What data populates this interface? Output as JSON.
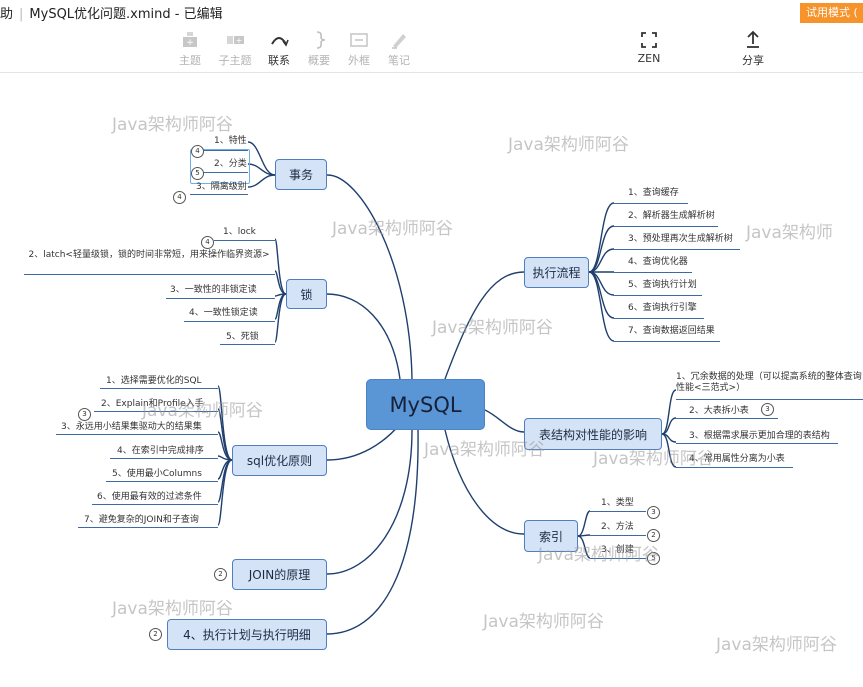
{
  "window": {
    "title_prefix": "助",
    "title": "MySQL优化问题.xmind - 已编辑",
    "trial_label": "试用模式 (",
    "toolbar": [
      {
        "label": "主题",
        "icon": "topic-icon",
        "enabled": false
      },
      {
        "label": "子主题",
        "icon": "subtopic-icon",
        "enabled": false
      },
      {
        "label": "联系",
        "icon": "relationship-icon",
        "enabled": true
      },
      {
        "label": "概要",
        "icon": "summary-icon",
        "enabled": false
      },
      {
        "label": "外框",
        "icon": "boundary-icon",
        "enabled": false
      },
      {
        "label": "笔记",
        "icon": "notes-icon",
        "enabled": false
      }
    ],
    "zen_label": "ZEN",
    "share_label": "分享"
  },
  "mindmap": {
    "center": "MySQL",
    "left_topics": [
      {
        "label": "事务",
        "children": [
          "1、特性",
          "2、分类",
          "3、隔离级别"
        ],
        "badges": [
          "4",
          "5",
          "4"
        ]
      },
      {
        "label": "锁",
        "children": [
          "1、lock",
          "2、latch<轻量级锁，锁的时间非常短，用来操作临界资源>",
          "3、一致性的非锁定读",
          "4、一致性锁定读",
          "5、死锁"
        ],
        "badges": [
          "4"
        ]
      },
      {
        "label": "sql优化原则",
        "children": [
          "1、选择需要优化的SQL",
          "2、Explain和Profile入手",
          "3、永远用小结果集驱动大的结果集",
          "4、在索引中完成排序",
          "5、使用最小Columns",
          "6、使用最有效的过滤条件",
          "7、避免复杂的JOIN和子查询"
        ],
        "badges": [
          "3"
        ]
      },
      {
        "label": "JOIN的原理",
        "children": [],
        "badges": [
          "2"
        ]
      },
      {
        "label": "4、执行计划与执行明细",
        "children": [],
        "badges": [
          "2"
        ]
      }
    ],
    "right_topics": [
      {
        "label": "执行流程",
        "children": [
          "1、查询缓存",
          "2、解析器生成解析树",
          "3、预处理再次生成解析树",
          "4、查询优化器",
          "5、查询执行计划",
          "6、查询执行引擎",
          "7、查询数据返回结果"
        ]
      },
      {
        "label": "表结构对性能的影响",
        "children": [
          "1、冗余数据的处理（可以提高系统的整体查询性能<三范式>）",
          "2、大表拆小表",
          "3、根据需求展示更加合理的表结构",
          "4、常用属性分离为小表"
        ],
        "badges": [
          "3"
        ]
      },
      {
        "label": "索引",
        "children": [
          "1、类型",
          "2、方法",
          "3、创建"
        ],
        "badges": [
          "3",
          "2",
          "5"
        ]
      }
    ]
  },
  "watermarks": [
    "Java架构师阿谷",
    "Java架构师阿谷",
    "Java架构师阿谷",
    "Java架构师",
    "Java架构师阿谷",
    "Java架构师阿谷",
    "Java架构师阿谷",
    "Java架构师阿谷",
    "Java架构师阿谷",
    "Java架构师阿谷",
    "Java架构师阿谷",
    "Java架构师阿谷"
  ],
  "colors": {
    "trial": "#f7932b",
    "center_fill": "#5a96d6",
    "topic_fill": "#d5e3f7",
    "line": "#1f3f6e"
  }
}
